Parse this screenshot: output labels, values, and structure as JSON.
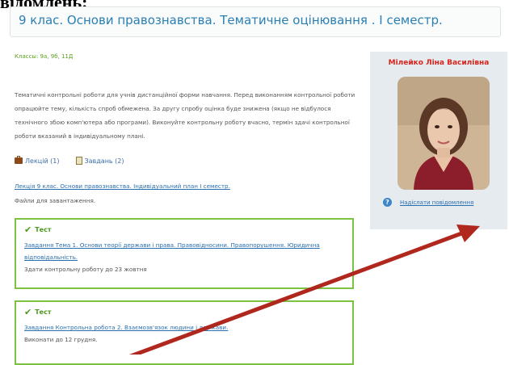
{
  "top_fragment": "відомлень:",
  "course": {
    "title": "9 клас. Основи правознавства. Тематичне оцінювання . І семестр.",
    "classes": "Классы: 9а, 9б, 11Д",
    "description": "Тематичні контрольні роботи для учнів дистанційної форми навчання. Перед виконанням контрольної роботи опрацюйте тему, кількість спроб обмежена. За другу спробу оцінка буде знижена (якщо не відбулося технічного збою комп'ютера або програми). Виконуйте контрольну роботу вчасно, термін здачі контрольної роботи вказаний в індивідуальному плані.",
    "lectures_label": "Лекцій (1)",
    "tasks_label": "Завдань (2)",
    "plan_link": "Лекція 9 клас. Основи правознавства. Індивідуальний план І семестр.",
    "files_label": "Файли для завантаження."
  },
  "tests": [
    {
      "label": "Тест",
      "link": "Завдання Тема 1. Основи теорії держави і права. Правовідносини. Правопорушення. Юридична відповідальність.",
      "note": "Здати контрольну роботу до 23 жовтня"
    },
    {
      "label": "Тест",
      "link": "Завдання Контрольна робота 2. Взаємозв'язок людини і держави.",
      "note": "Виконати до 12 грудня."
    }
  ],
  "teacher": {
    "name": "Мілейко Ліна Василівна",
    "message_link": "Надіслати повідомлення"
  },
  "colors": {
    "title_blue": "#2a7fb5",
    "green": "#7cc242",
    "teacher_red": "#d8241c",
    "arrow_red": "#b0271d"
  }
}
